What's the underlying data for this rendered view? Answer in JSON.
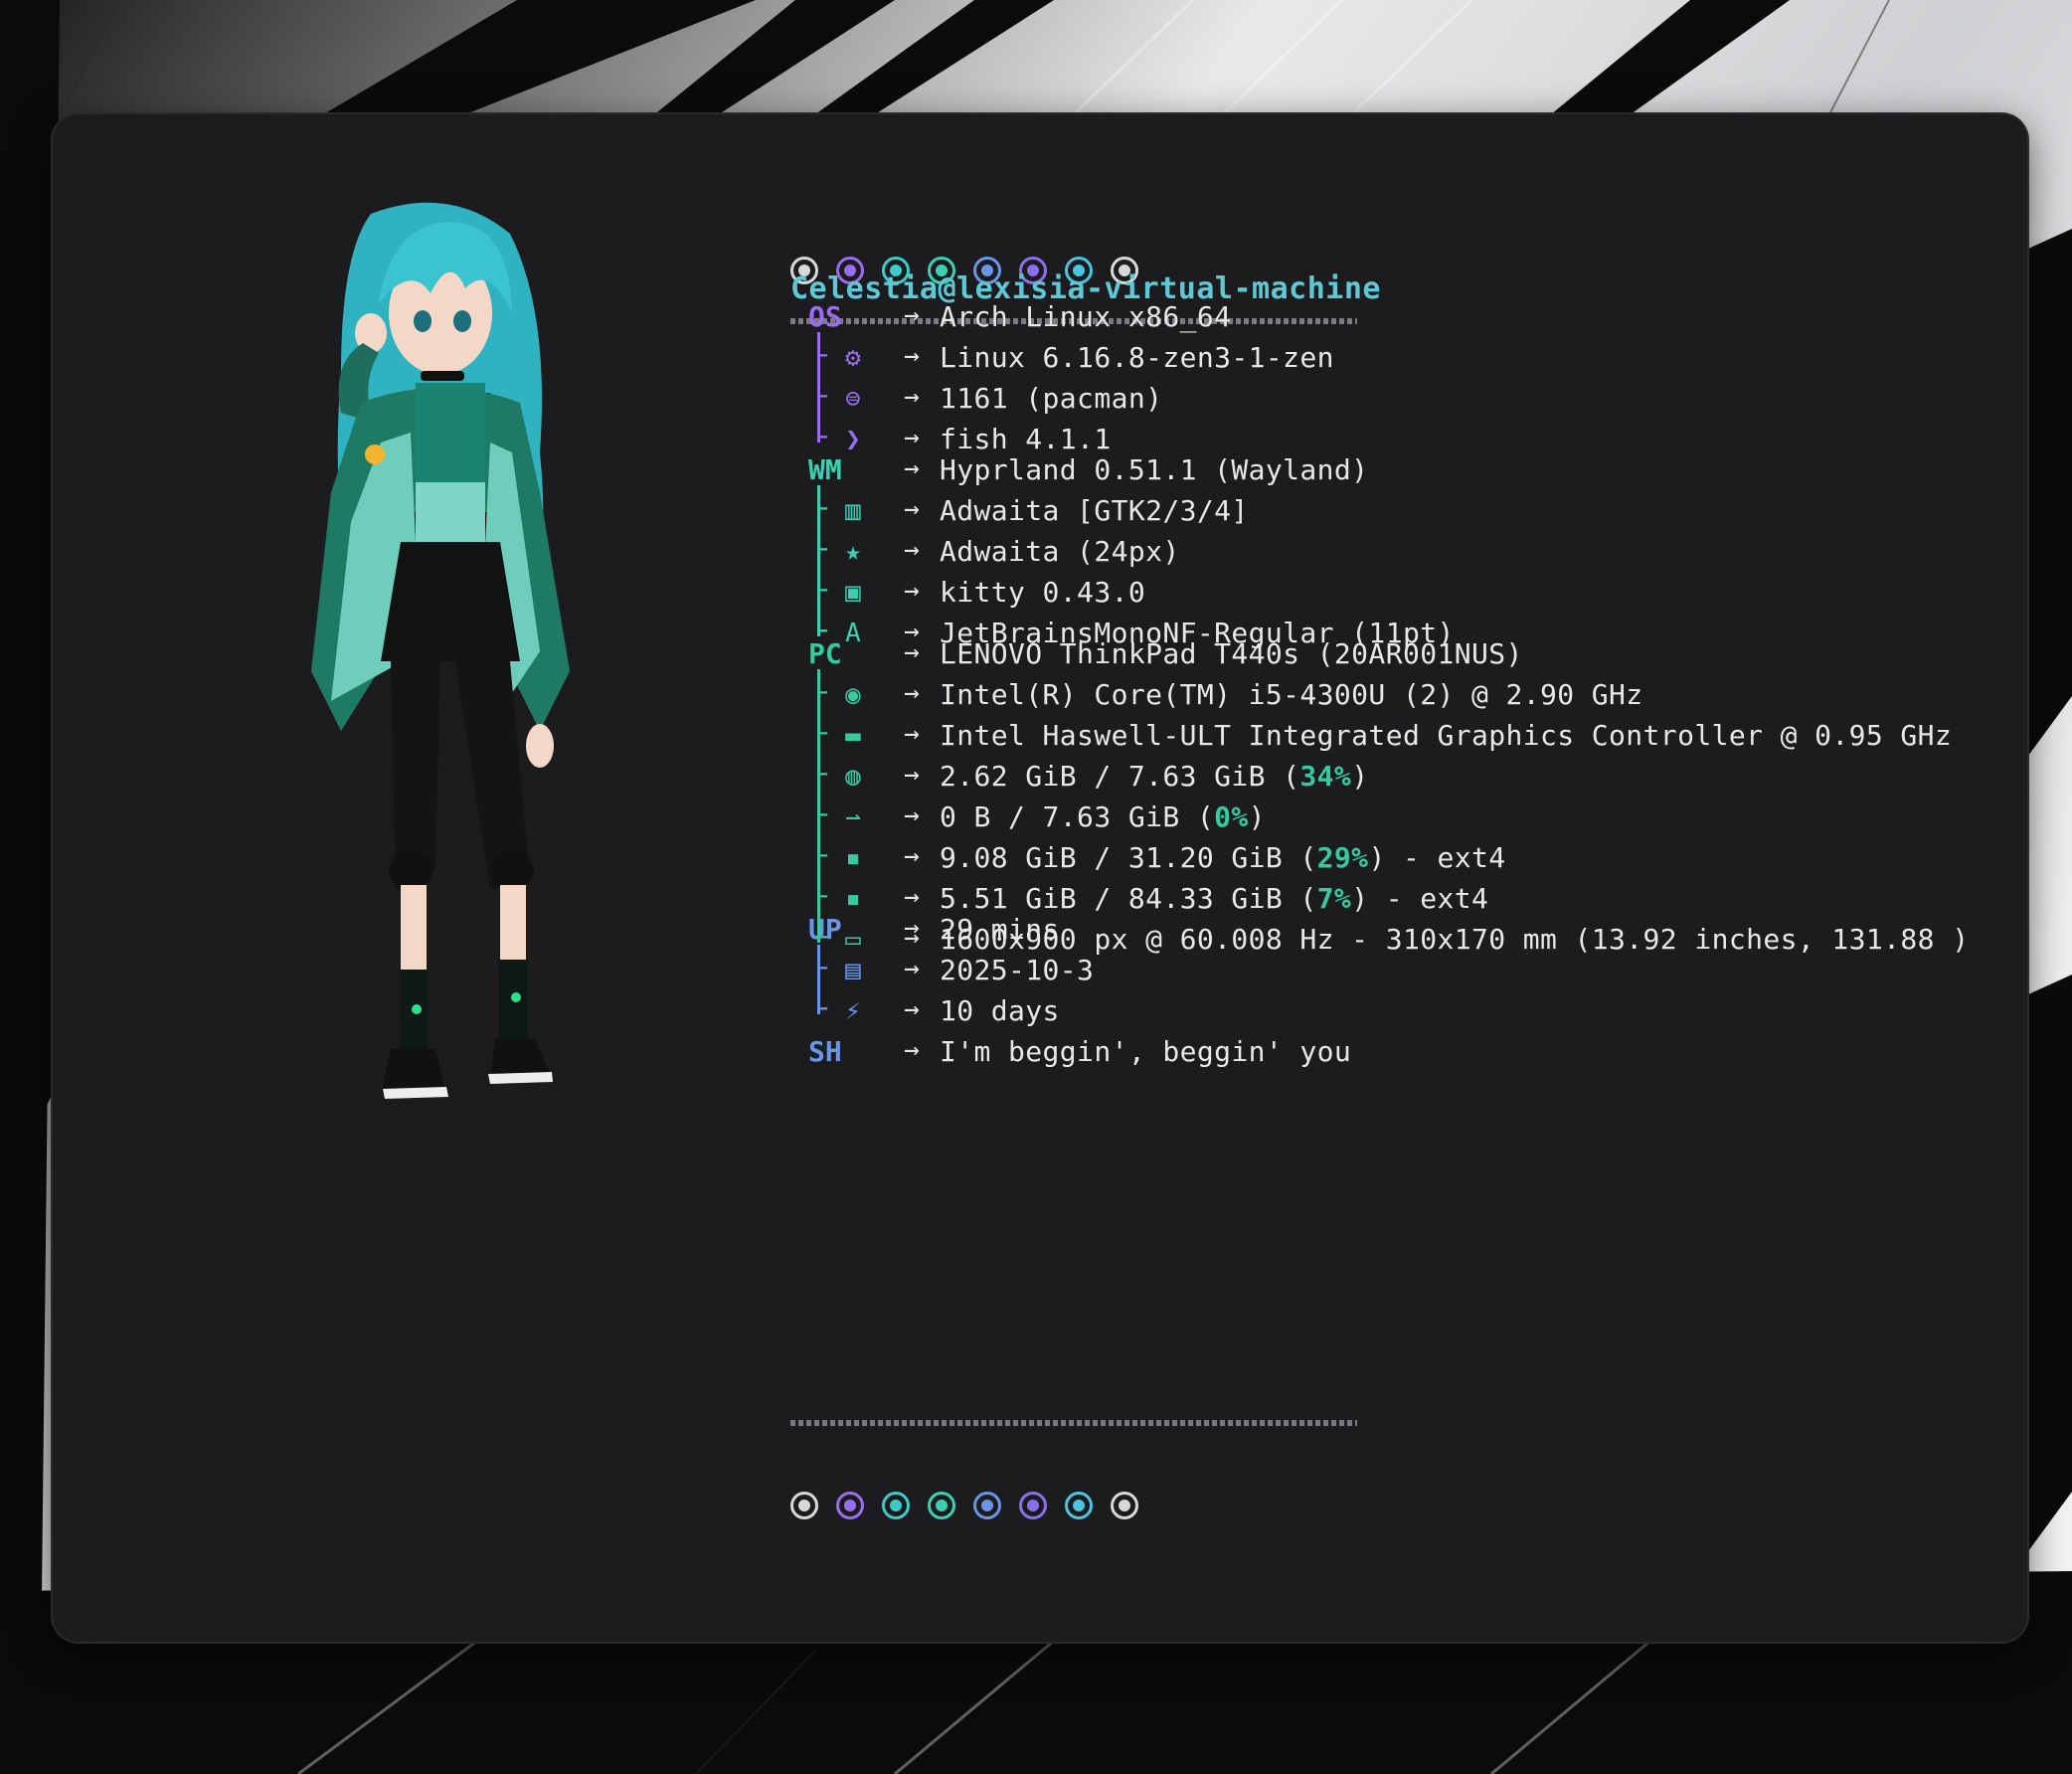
{
  "colors": {
    "purple": "#9a6cf0",
    "blue": "#6a96e8",
    "teal": "#3bd0b3",
    "cyan": "#5ec9d6",
    "white": "#d8d8d8",
    "green": "#37c9a0",
    "window_bg": "#1c1c1e"
  },
  "dots": [
    {
      "color": "#d8d8d8"
    },
    {
      "color": "#9a6cf0"
    },
    {
      "color": "#3fc9c9"
    },
    {
      "color": "#3bd0b3"
    },
    {
      "color": "#6a96e8"
    },
    {
      "color": "#8a70ec"
    },
    {
      "color": "#4cc3df"
    },
    {
      "color": "#d8d8d8"
    }
  ],
  "hostname": "Celestia@lexisia-virtual-machine",
  "arrow": "→",
  "groups": {
    "os": {
      "label": "OS",
      "color": "#9a6cf0",
      "rows": [
        {
          "icon": "arch-icon",
          "value": "Arch Linux x86_64"
        },
        {
          "icon": "kernel-gear-icon",
          "value": "Linux 6.16.8-zen3-1-zen"
        },
        {
          "icon": "package-icon",
          "value": "1161 (pacman)"
        },
        {
          "icon": "terminal-prompt-icon",
          "value": "fish 4.1.1"
        }
      ]
    },
    "wm": {
      "label": "WM",
      "color": "#3bd0b3",
      "rows": [
        {
          "icon": "wm-icon",
          "value": "Hyprland 0.51.1 (Wayland)"
        },
        {
          "icon": "theme-columns-icon",
          "value": "Adwaita [GTK2/3/4]"
        },
        {
          "icon": "star-icon",
          "value": "Adwaita (24px)"
        },
        {
          "icon": "terminal-window-icon",
          "value": "kitty 0.43.0"
        },
        {
          "icon": "font-icon",
          "value": "JetBrainsMonoNF-Regular (11pt)"
        }
      ]
    },
    "pc": {
      "label": "PC",
      "color": "#37c9a0",
      "rows": [
        {
          "icon": "computer-icon",
          "value": "LENOVO ThinkPad T440s (20AR001NUS)"
        },
        {
          "icon": "cpu-icon",
          "value": "Intel(R) Core(TM) i5-4300U (2) @ 2.90 GHz"
        },
        {
          "icon": "gpu-icon",
          "value": "Intel Haswell-ULT Integrated Graphics Controller @ 0.95 GHz"
        },
        {
          "icon": "memory-icon",
          "value": "2.62 GiB / 7.63 GiB (",
          "pct": "34%",
          "suffix": ")"
        },
        {
          "icon": "swap-icon",
          "value": "0 B / 7.63 GiB (",
          "pct": "0%",
          "suffix": ")"
        },
        {
          "icon": "disk-icon",
          "value": "9.08 GiB / 31.20 GiB (",
          "pct": "29%",
          "suffix": ") - ext4"
        },
        {
          "icon": "disk-icon",
          "value": "5.51 GiB / 84.33 GiB (",
          "pct": "7%",
          "suffix": ") - ext4"
        },
        {
          "icon": "monitor-icon",
          "value": "1600x900 px @ 60.008 Hz - 310x170 mm (13.92 inches, 131.88 )"
        }
      ]
    },
    "up": {
      "label": "UP",
      "color": "#6a96e8",
      "rows": [
        {
          "icon": "uptime-icon",
          "value": "29 mins"
        },
        {
          "icon": "calendar-icon",
          "value": "2025-10-3"
        },
        {
          "icon": "bolt-icon",
          "value": "10 days"
        }
      ]
    },
    "sh": {
      "label": "SH",
      "color": "#6a96e8",
      "rows": [
        {
          "icon": "none",
          "value": "I'm beggin', beggin' you"
        }
      ]
    }
  }
}
